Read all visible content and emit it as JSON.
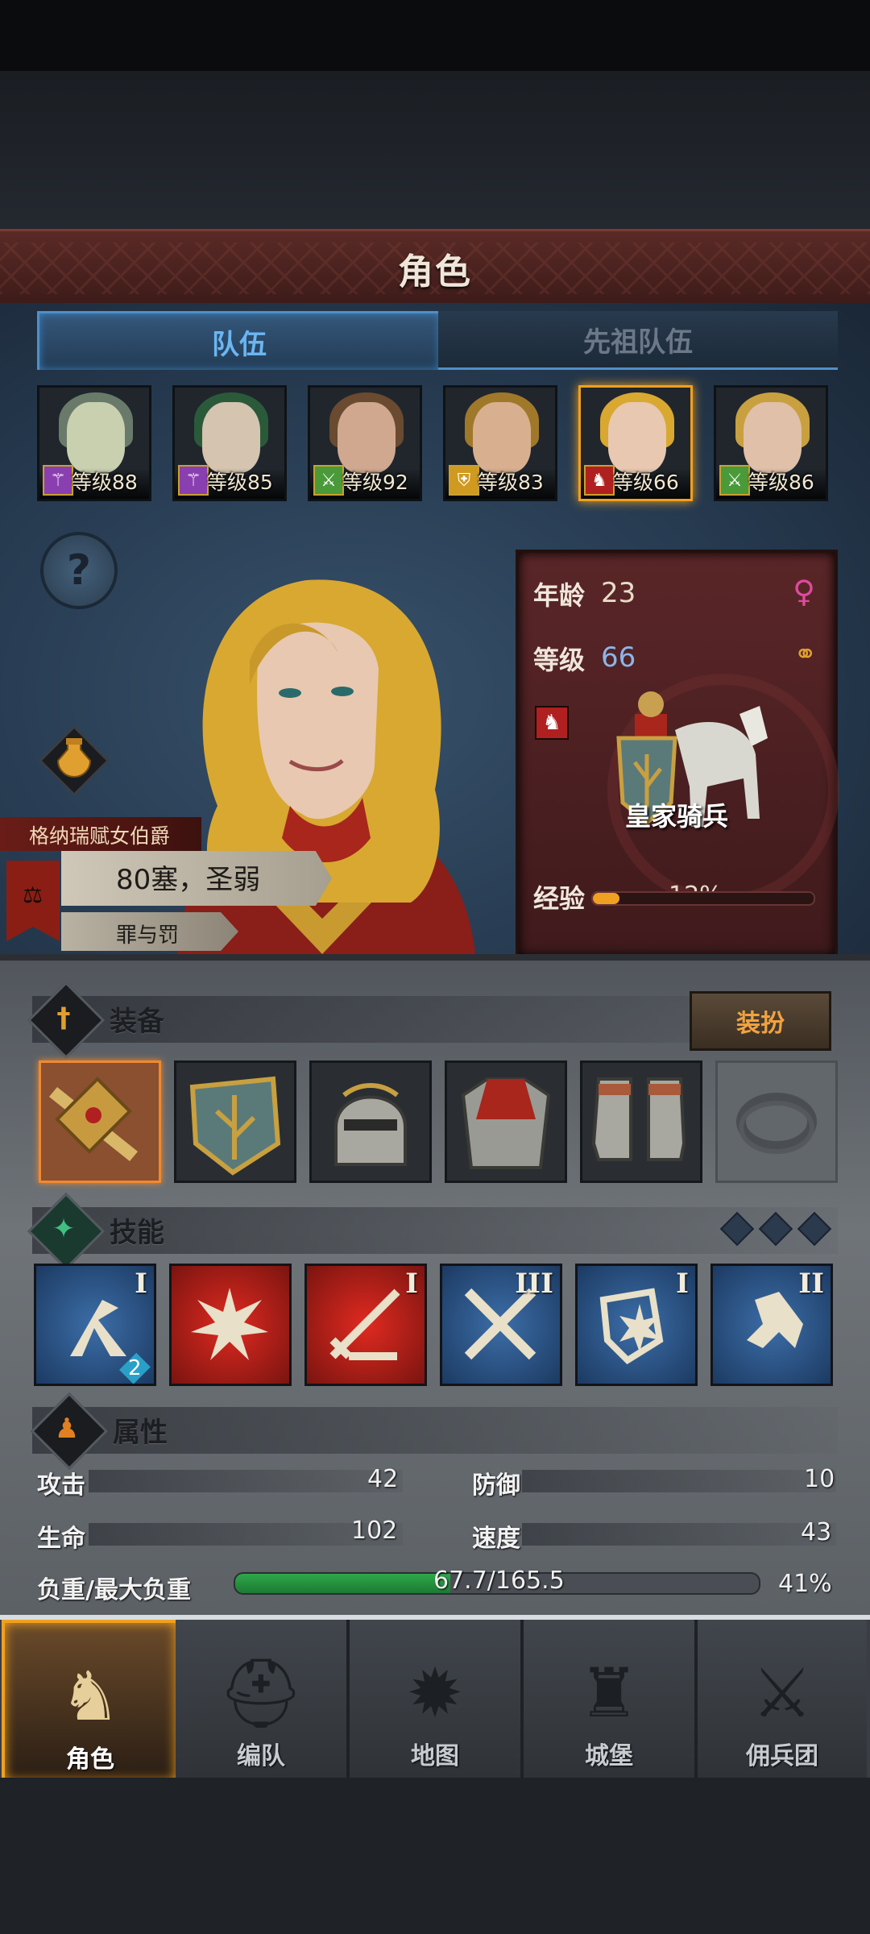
{
  "header": {
    "title": "角色"
  },
  "tabs": {
    "team": "队伍",
    "ancestor": "先祖队伍"
  },
  "roster": [
    {
      "level": "等级88",
      "class_icon": "staff-icon",
      "class_color": "#8a3fb0",
      "hair": "#6a7a6a",
      "skin": "#c8d0b0",
      "selected": false
    },
    {
      "level": "等级85",
      "class_icon": "staff-icon",
      "class_color": "#8a3fb0",
      "hair": "#2a5a3a",
      "skin": "#d4c4b0",
      "selected": false
    },
    {
      "level": "等级92",
      "class_icon": "crossed-swords-icon",
      "class_color": "#4a9a3a",
      "hair": "#6a4a30",
      "skin": "#d0a890",
      "selected": false
    },
    {
      "level": "等级83",
      "class_icon": "shield-icon",
      "class_color": "#d09a20",
      "hair": "#a0782a",
      "skin": "#d8b090",
      "selected": false
    },
    {
      "level": "等级66",
      "class_icon": "horse-icon",
      "class_color": "#b02020",
      "hair": "#d8a830",
      "skin": "#e8c8b0",
      "selected": true
    },
    {
      "level": "等级86",
      "class_icon": "crossed-swords-icon",
      "class_color": "#4a9a3a",
      "hair": "#c8a040",
      "skin": "#e0c0a8",
      "selected": false
    }
  ],
  "character": {
    "noble_title": "格纳瑞赋女伯爵",
    "trait": "80塞，圣弱",
    "sin": "罪与罚"
  },
  "info": {
    "age_label": "年龄",
    "age": "23",
    "level_label": "等级",
    "level": "66",
    "class_name": "皇家骑兵",
    "exp_label": "经验",
    "exp_percent": "12%",
    "exp_fraction": 0.12,
    "gender_color": "#e04aa0",
    "ring_color": "#e0a030"
  },
  "equipment": {
    "title": "装备",
    "dress_button": "装扮",
    "slots": [
      "weapon-icon",
      "shield-icon",
      "helmet-icon",
      "armor-icon",
      "boots-icon",
      "ring-icon"
    ]
  },
  "skills": {
    "title": "技能",
    "items": [
      {
        "icon": "horse-charge-icon",
        "tier": "I",
        "color": "blue",
        "badge": "2"
      },
      {
        "icon": "burst-strike-icon",
        "tier": "",
        "color": "red",
        "badge": ""
      },
      {
        "icon": "lance-icon",
        "tier": "I",
        "color": "red",
        "badge": ""
      },
      {
        "icon": "crossed-swords-icon",
        "tier": "III",
        "color": "blue",
        "badge": ""
      },
      {
        "icon": "shield-bash-icon",
        "tier": "I",
        "color": "blue",
        "badge": ""
      },
      {
        "icon": "horse-head-icon",
        "tier": "II",
        "color": "blue",
        "badge": ""
      }
    ]
  },
  "attributes": {
    "title": "属性",
    "attack_label": "攻击",
    "attack": "42",
    "defense_label": "防御",
    "defense": "10",
    "life_label": "生命",
    "life": "102",
    "speed_label": "速度",
    "speed": "43",
    "load_label": "负重/最大负重",
    "load": "67.7/165.5",
    "load_percent": "41%",
    "load_fraction": 0.41
  },
  "nav": [
    {
      "label": "角色",
      "icon": "knight-icon",
      "active": true
    },
    {
      "label": "编队",
      "icon": "helmet-icon",
      "active": false
    },
    {
      "label": "地图",
      "icon": "compass-icon",
      "active": false
    },
    {
      "label": "城堡",
      "icon": "castle-icon",
      "active": false
    },
    {
      "label": "佣兵团",
      "icon": "mercenary-icon",
      "active": false
    }
  ]
}
